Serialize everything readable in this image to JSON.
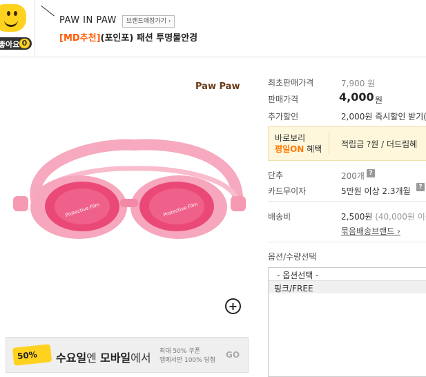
{
  "like": {
    "label": "좋아요",
    "count": "0"
  },
  "brand": {
    "name": "PAW IN PAW",
    "store_button": "브랜드매장가기 ›"
  },
  "product": {
    "tag": "[MD추천]",
    "title": "(포인포) 패션 투명물안경"
  },
  "image": {
    "logo_text": "Paw Paw",
    "lens_text_left": "Protective Film",
    "lens_text_right": "Protective Film"
  },
  "banner": {
    "badge": "50%",
    "main_prefix": "수요일",
    "main_mid": "엔 ",
    "main_strong": "모바일",
    "main_suffix": "에서",
    "sub1": "최대 50% 쿠폰",
    "sub2": "앱에서만 100% 당첨",
    "go": "GO"
  },
  "info": {
    "min_price_label": "최초판매가격",
    "min_price_value": "7,900 원",
    "sale_price_label": "판매가격",
    "sale_price_value": "4,000",
    "sale_price_unit": "원",
    "extra_discount_label": "추가할인",
    "extra_discount_value": "2,000원 즉시할인 받기(",
    "baro_line1": "바로보리",
    "baro_line2_hl": "평일ON",
    "baro_line2_rest": " 혜택",
    "baro_right": "적립금 ?원 / 더드림혜",
    "unit_label": "단추",
    "unit_value": "200개",
    "card_label": "카드무이자",
    "card_value": "5만원 이상 2.3개월",
    "shipping_label": "배송비",
    "shipping_value": "2,500원",
    "shipping_note": "(40,000원 이상",
    "bundle_link": "묶음배송브랜드 ›",
    "option_label": "옵션/수량선택",
    "option_select": "- 옵션선택 -",
    "option_item": "핑크/FREE",
    "help_icon": "?"
  },
  "colors": {
    "accent_orange": "#ff5a00",
    "yellow": "#ffd21f",
    "goggle_pink": "#f48aa6",
    "lens_pink": "#e8386b"
  }
}
